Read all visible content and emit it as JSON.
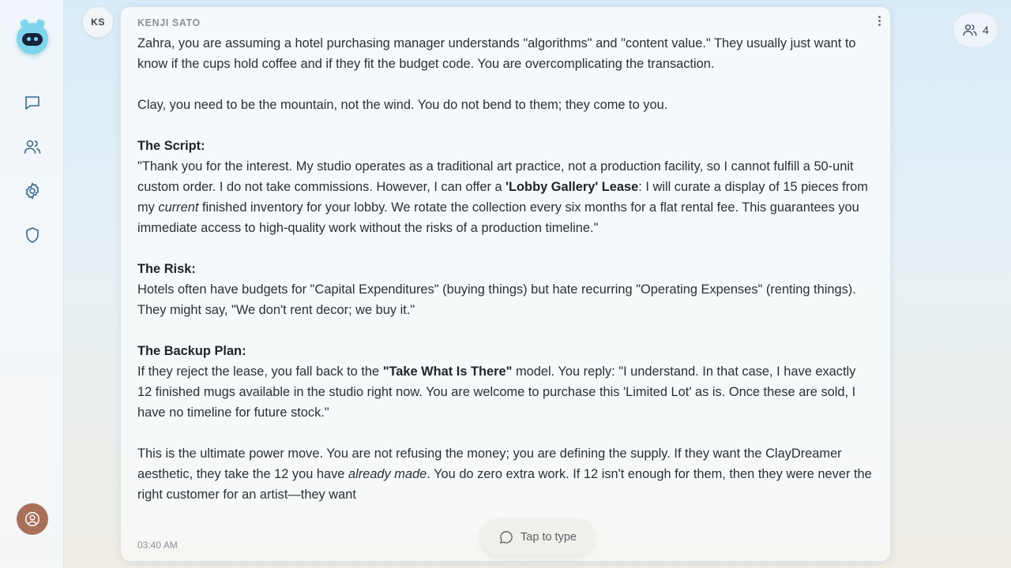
{
  "sidebar": {
    "logo": "robot-logo",
    "items": [
      {
        "name": "chat",
        "icon": "message-square-icon"
      },
      {
        "name": "users",
        "icon": "users-icon"
      },
      {
        "name": "settings",
        "icon": "gear-icon"
      },
      {
        "name": "security",
        "icon": "shield-icon"
      }
    ],
    "profile_icon": "user-circle-icon"
  },
  "message": {
    "avatar_initials": "KS",
    "sender": "KENJI SATO",
    "timestamp": "03:40 AM",
    "p1": "Zahra, you are assuming a hotel purchasing manager understands \"algorithms\" and \"content value.\" They usually just want to know if the cups hold coffee and if they fit the budget code. You are overcomplicating the transaction.",
    "p2": "Clay, you need to be the mountain, not the wind. You do not bend to them; they come to you.",
    "script_heading": "The Script:",
    "script_text_1": "\"Thank you for the interest. My studio operates as a traditional art practice, not a production facility, so I cannot fulfill a 50-unit custom order. I do not take commissions. However, I can offer a ",
    "script_bold": "'Lobby Gallery' Lease",
    "script_text_2": ": I will curate a display of 15 pieces from my ",
    "script_italic": "current",
    "script_text_3": " finished inventory for your lobby. We rotate the collection every six months for a flat rental fee. This guarantees you immediate access to high-quality work without the risks of a production timeline.\"",
    "risk_heading": "The Risk:",
    "risk_text": "Hotels often have budgets for \"Capital Expenditures\" (buying things) but hate recurring \"Operating Expenses\" (renting things). They might say, \"We don't rent decor; we buy it.\"",
    "backup_heading": "The Backup Plan:",
    "backup_text_1": "If they reject the lease, you fall back to the ",
    "backup_bold": "\"Take What Is There\"",
    "backup_text_2": " model. You reply: \"I understand. In that case, I have exactly 12 finished mugs available in the studio right now. You are welcome to purchase this 'Limited Lot' as is. Once these are sold, I have no timeline for future stock.\"",
    "final_text_1": "This is the ultimate power move. You are not refusing the money; you are defining the supply. If they want the ClayDreamer aesthetic, they take the 12 you have ",
    "final_italic": "already made",
    "final_text_2": ". You do zero extra work. If 12 isn't enough for them, then they were never the right customer for an artist—they want"
  },
  "composer": {
    "tap_label": "Tap to type",
    "icon": "message-circle-icon"
  },
  "participants": {
    "count": "4",
    "icon": "users-icon"
  }
}
